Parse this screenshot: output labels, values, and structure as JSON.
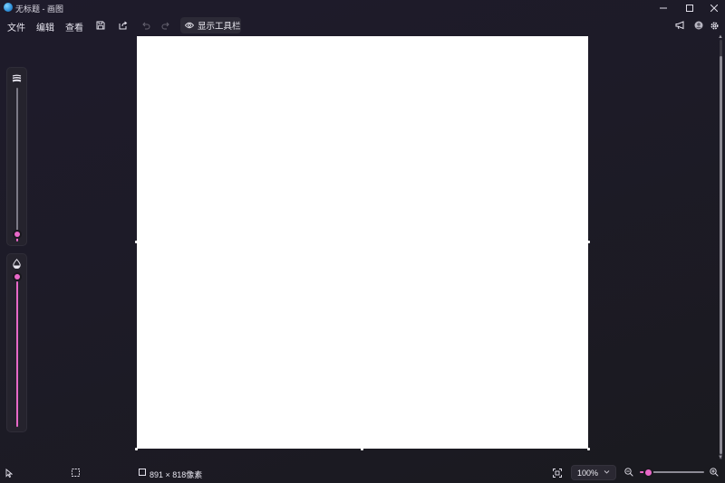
{
  "window": {
    "title": "无标题 - 画图",
    "minimize_icon": "minimize-icon",
    "maximize_icon": "maximize-icon",
    "close_icon": "close-icon"
  },
  "menu": {
    "file": "文件",
    "edit": "编辑",
    "view": "查看"
  },
  "toolbar": {
    "save_icon": "save-icon",
    "share_icon": "share-icon",
    "undo_icon": "undo-icon",
    "redo_icon": "redo-icon",
    "show_toolbar_label": "显示工具栏",
    "show_toolbar_icon": "eye-icon",
    "feedback_icon": "megaphone-icon",
    "account_icon": "avatar-icon",
    "settings_icon": "gear-icon"
  },
  "side_sliders": {
    "size_icon": "brush-size-icon",
    "opacity_icon": "opacity-drop-icon",
    "accent_color": "#e868c8"
  },
  "canvas": {
    "background": "#ffffff"
  },
  "status": {
    "dimensions": "891 × 818像素",
    "select_icon": "pointer-icon",
    "selection_icon": "selection-icon",
    "canvas_size_icon": "canvas-size-icon"
  },
  "zoom": {
    "value": "100%",
    "fit_icon": "fit-to-window-icon",
    "zoom_out_icon": "zoom-out-icon",
    "zoom_in_icon": "zoom-in-icon",
    "level_fraction": 0.15
  }
}
